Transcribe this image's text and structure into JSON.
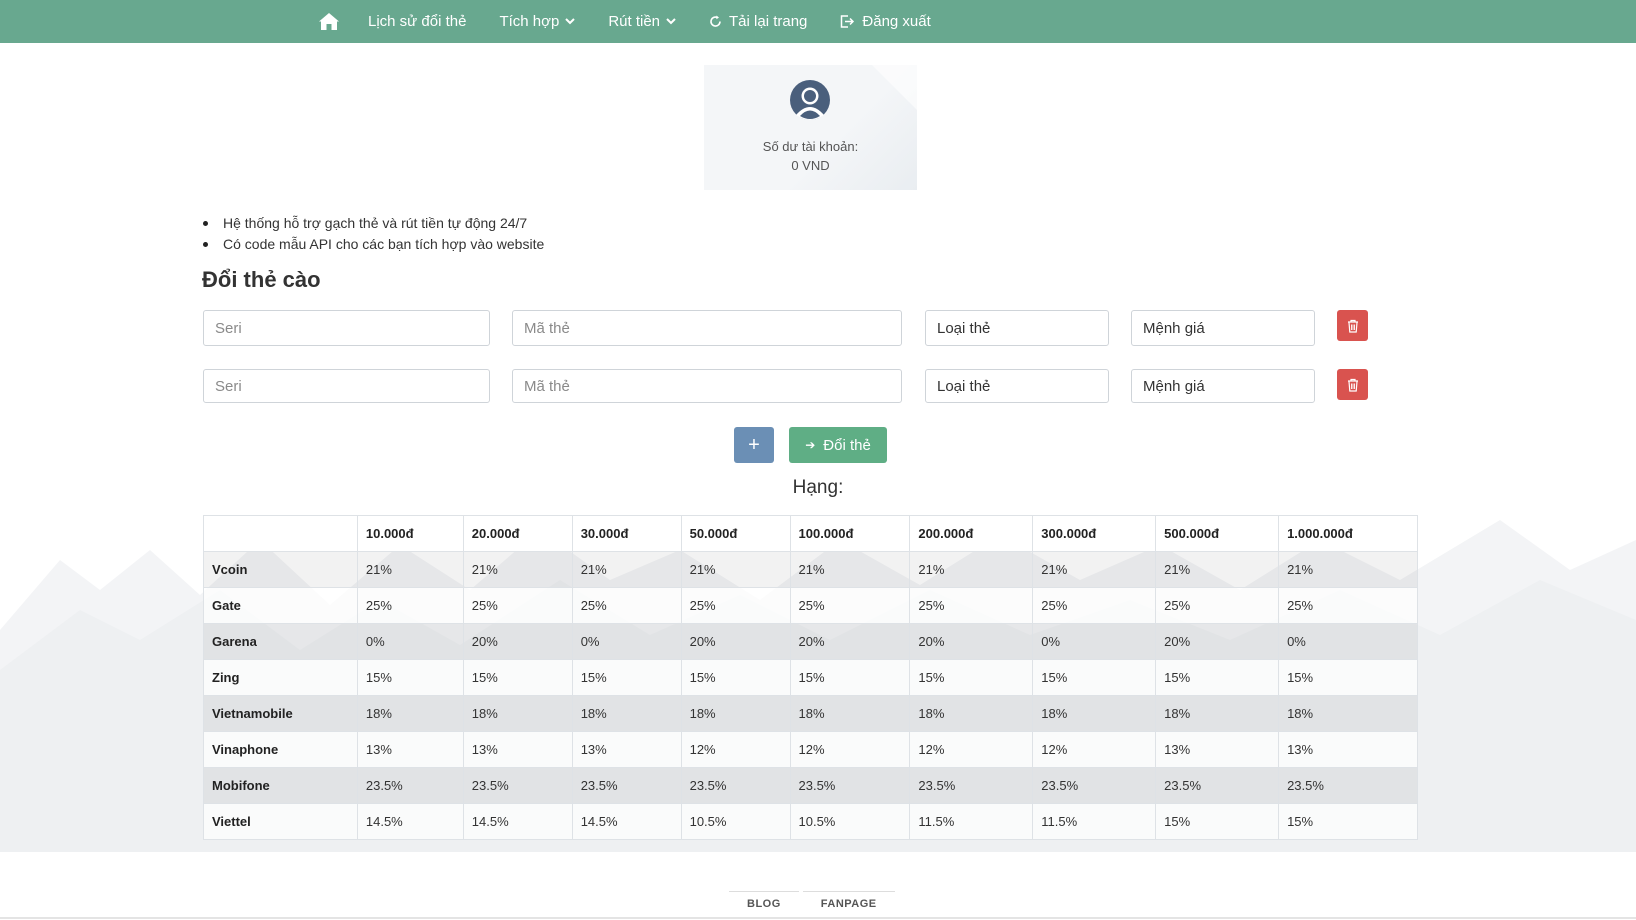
{
  "nav": {
    "home_icon": "home-icon",
    "items": [
      {
        "label": "Lịch sử đổi thẻ"
      },
      {
        "label": "Tích hợp"
      },
      {
        "label": "Rút tiền"
      },
      {
        "label": "Tải lại trang"
      },
      {
        "label": "Đăng xuất"
      }
    ]
  },
  "balance": {
    "label": "Số dư tài khoản:",
    "value": "0 VND"
  },
  "info": [
    "Hệ thống hỗ trợ gạch thẻ và rút tiền tự động 24/7",
    "Có code mẫu API cho các bạn tích hợp vào website"
  ],
  "section_title": "Đổi thẻ cào",
  "form": {
    "rows": [
      {
        "seri": "Seri",
        "code": "Mã thẻ",
        "type": "Loại thẻ",
        "amount": "Mệnh giá"
      },
      {
        "seri": "Seri",
        "code": "Mã thẻ",
        "type": "Loại thẻ",
        "amount": "Mệnh giá"
      }
    ],
    "add_label": "+",
    "submit_label": "Đổi thẻ"
  },
  "rank_title": "Hạng:",
  "table": {
    "headers": [
      "",
      "10.000đ",
      "20.000đ",
      "30.000đ",
      "50.000đ",
      "100.000đ",
      "200.000đ",
      "300.000đ",
      "500.000đ",
      "1.000.000đ"
    ],
    "rows": [
      {
        "name": "Vcoin",
        "cells": [
          "21%",
          "21%",
          "21%",
          "21%",
          "21%",
          "21%",
          "21%",
          "21%",
          "21%"
        ]
      },
      {
        "name": "Gate",
        "cells": [
          "25%",
          "25%",
          "25%",
          "25%",
          "25%",
          "25%",
          "25%",
          "25%",
          "25%"
        ]
      },
      {
        "name": "Garena",
        "cells": [
          "0%",
          "20%",
          "0%",
          "20%",
          "20%",
          "20%",
          "0%",
          "20%",
          "0%"
        ]
      },
      {
        "name": "Zing",
        "cells": [
          "15%",
          "15%",
          "15%",
          "15%",
          "15%",
          "15%",
          "15%",
          "15%",
          "15%"
        ]
      },
      {
        "name": "Vietnamobile",
        "cells": [
          "18%",
          "18%",
          "18%",
          "18%",
          "18%",
          "18%",
          "18%",
          "18%",
          "18%"
        ]
      },
      {
        "name": "Vinaphone",
        "cells": [
          "13%",
          "13%",
          "13%",
          "12%",
          "12%",
          "12%",
          "12%",
          "13%",
          "13%"
        ]
      },
      {
        "name": "Mobifone",
        "cells": [
          "23.5%",
          "23.5%",
          "23.5%",
          "23.5%",
          "23.5%",
          "23.5%",
          "23.5%",
          "23.5%",
          "23.5%"
        ]
      },
      {
        "name": "Viettel",
        "cells": [
          "14.5%",
          "14.5%",
          "14.5%",
          "10.5%",
          "10.5%",
          "11.5%",
          "11.5%",
          "15%",
          "15%"
        ]
      }
    ]
  },
  "footer": {
    "links": [
      "BLOG",
      "FANPAGE"
    ]
  },
  "colors": {
    "navbar": "#68a88f",
    "delete": "#d9534f",
    "add": "#6b8fb5",
    "submit": "#5fae85"
  }
}
